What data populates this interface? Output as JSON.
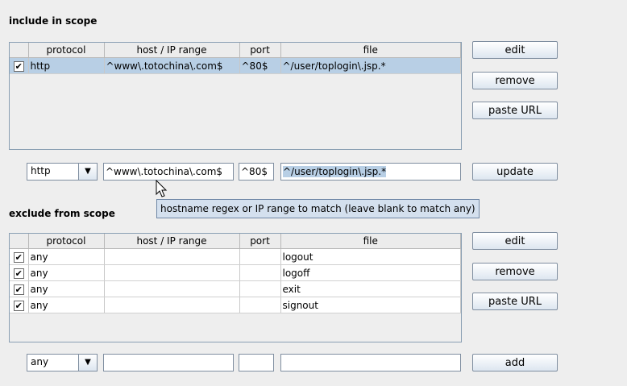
{
  "include": {
    "title": "include in scope",
    "columns": [
      "protocol",
      "host / IP range",
      "port",
      "file"
    ],
    "rows": [
      {
        "checked": true,
        "protocol": "http",
        "host": "^www\\.totochina\\.com$",
        "port": "^80$",
        "file": "^/user/toplogin\\.jsp.*"
      }
    ],
    "buttons": {
      "edit": "edit",
      "remove": "remove",
      "paste": "paste URL"
    },
    "editor": {
      "protocol": "http",
      "host": "^www\\.totochina\\.com$",
      "port": "^80$",
      "file": "^/user/toplogin\\.jsp.*",
      "action": "update"
    }
  },
  "exclude": {
    "title": "exclude from scope",
    "columns": [
      "protocol",
      "host / IP range",
      "port",
      "file"
    ],
    "rows": [
      {
        "checked": true,
        "protocol": "any",
        "host": "",
        "port": "",
        "file": "logout"
      },
      {
        "checked": true,
        "protocol": "any",
        "host": "",
        "port": "",
        "file": "logoff"
      },
      {
        "checked": true,
        "protocol": "any",
        "host": "",
        "port": "",
        "file": "exit"
      },
      {
        "checked": true,
        "protocol": "any",
        "host": "",
        "port": "",
        "file": "signout"
      }
    ],
    "buttons": {
      "edit": "edit",
      "remove": "remove",
      "paste": "paste URL"
    },
    "editor": {
      "protocol": "any",
      "host": "",
      "port": "",
      "file": "",
      "action": "add"
    }
  },
  "tooltip": "hostname regex or IP range to match (leave blank to match any)",
  "icons": {
    "checkbox": "checkmark-glyph",
    "dropdown": "chevron-down-icon",
    "cursor": "mouse-pointer-icon"
  }
}
